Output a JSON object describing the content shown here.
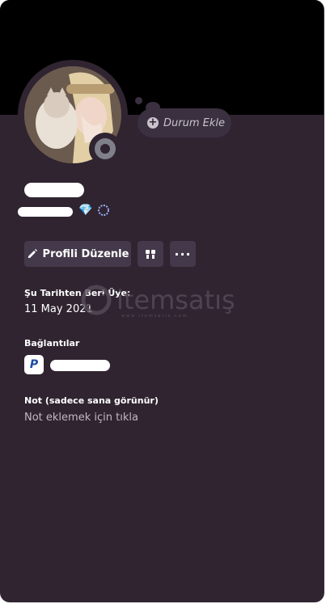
{
  "profile": {
    "status_button_label": "Durum Ekle",
    "edit_profile_label": "Profili Düzenle",
    "more_label": "···"
  },
  "member_since": {
    "title": "Şu Tarihten Beri Üye:",
    "value": "11 May 2021"
  },
  "connections": {
    "title": "Bağlantılar",
    "items": [
      {
        "service_icon": "paypal-icon"
      }
    ]
  },
  "note": {
    "title": "Not (sadece sana görünür)",
    "placeholder": "Not eklemek için tıkla"
  },
  "watermark": {
    "brand": "itemsatış",
    "subtitle": "www.itemsatis.com"
  },
  "colors": {
    "card_bg": "#2f2430",
    "banner": "#000000",
    "button_bg": "#44394a",
    "status_offline": "#7f808a"
  }
}
